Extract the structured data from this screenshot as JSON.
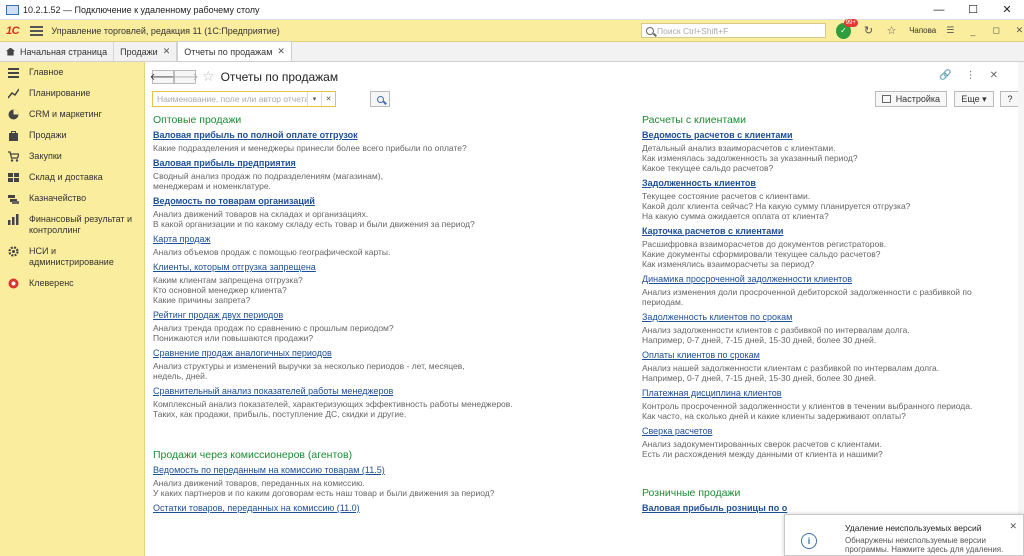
{
  "window": {
    "title": "10.2.1.52 — Подключение к удаленному рабочему столу",
    "controls": [
      "—",
      "☐",
      "✕"
    ]
  },
  "appbar": {
    "logo": "1С",
    "title": "Управление торговлей, редакция 11  (1С:Предприятие)",
    "search_placeholder": "Поиск Ctrl+Shift+F",
    "notif_count": "99+",
    "user": "Чапова",
    "menu": "☰",
    "controls": [
      "_",
      "◻",
      "✕"
    ]
  },
  "tabs": [
    {
      "label": "Начальная страница",
      "closable": false
    },
    {
      "label": "Продажи",
      "closable": true
    },
    {
      "label": "Отчеты по продажам",
      "closable": true,
      "active": true
    }
  ],
  "sidebar": {
    "items": [
      {
        "label": "Главное",
        "icon": "menu-icon"
      },
      {
        "label": "Планирование",
        "icon": "chart-icon"
      },
      {
        "label": "CRM и маркетинг",
        "icon": "pie-icon"
      },
      {
        "label": "Продажи",
        "icon": "bag-icon"
      },
      {
        "label": "Закупки",
        "icon": "cart-icon"
      },
      {
        "label": "Склад и доставка",
        "icon": "warehouse-icon"
      },
      {
        "label": "Казначейство",
        "icon": "money-icon"
      },
      {
        "label": "Финансовый результат и контроллинг",
        "icon": "finance-icon"
      },
      {
        "label": "НСИ и администрирование",
        "icon": "gear-icon"
      },
      {
        "label": "Клеверенс",
        "icon": "cleverence-icon"
      }
    ]
  },
  "page": {
    "title": "Отчеты по продажам",
    "back": "🡐",
    "forward": "🡒",
    "filter_placeholder": "Наименование, поле или автор отчета",
    "settings_label": "Настройка",
    "more_label": "Еще",
    "help_label": "?"
  },
  "left_groups": [
    {
      "title": "Оптовые продажи",
      "reports": [
        {
          "name": "Валовая прибыль по полной оплате отгрузок",
          "bold": true,
          "desc": [
            "Какие подразделения и менеджеры принесли более всего прибыли по оплате?"
          ]
        },
        {
          "name": "Валовая прибыль предприятия",
          "bold": true,
          "desc": [
            "Сводный анализ продаж по подразделениям (магазинам),",
            "менеджерам и номенклатуре."
          ]
        },
        {
          "name": "Ведомость по товарам организаций",
          "bold": true,
          "desc": [
            "Анализ движений товаров на складах и организациях.",
            "В какой организации и по какому складу есть товар и были движения за период?"
          ]
        },
        {
          "name": "Карта продаж",
          "bold": false,
          "desc": [
            "Анализ объемов продаж с помощью географической карты."
          ]
        },
        {
          "name": "Клиенты, которым отгрузка запрещена",
          "bold": false,
          "desc": [
            "Каким клиентам запрещена отгрузка?",
            "Кто основной менеджер клиента?",
            "Какие причины запрета?"
          ]
        },
        {
          "name": "Рейтинг продаж двух периодов",
          "bold": false,
          "desc": [
            "Анализ тренда продаж по сравнению с прошлым периодом?",
            "Понижаются или повышаются продажи?"
          ]
        },
        {
          "name": "Сравнение продаж аналогичных периодов",
          "bold": false,
          "desc": [
            "Анализ структуры и изменений выручки за несколько периодов - лет, месяцев,",
            "недель, дней."
          ]
        },
        {
          "name": "Сравнительный анализ показателей работы менеджеров",
          "bold": false,
          "desc": [
            "Комплексный анализ показателей, характеризующих эффективность работы менеджеров.",
            "Таких, как продажи, прибыль, поступление ДС, скидки и другие."
          ]
        }
      ]
    },
    {
      "title": "Продажи через комиссионеров (агентов)",
      "reports": [
        {
          "name": "Ведомость по переданным на комиссию товарам (11.5)",
          "bold": false,
          "desc": [
            "Анализ движений товаров, переданных на комиссию.",
            "У каких партнеров и по каким договорам есть наш товар и были движения за период?"
          ]
        },
        {
          "name": "Остатки товаров, переданных на комиссию (11.0)",
          "bold": false,
          "desc": []
        }
      ]
    }
  ],
  "right_groups": [
    {
      "title": "Расчеты с клиентами",
      "reports": [
        {
          "name": "Ведомость расчетов с клиентами",
          "bold": true,
          "desc": [
            "Детальный анализ взаиморасчетов с клиентами.",
            "Как изменялась задолженность за указанный период?",
            "Какое текущее сальдо расчетов?"
          ]
        },
        {
          "name": "Задолженность клиентов",
          "bold": true,
          "desc": [
            "Текущее состояние расчетов с клиентами.",
            "Какой долг клиента сейчас? На какую сумму планируется отгрузка?",
            "На какую сумма ожидается оплата от клиента?"
          ]
        },
        {
          "name": "Карточка расчетов с клиентами",
          "bold": true,
          "desc": [
            "Расшифровка взаиморасчетов до документов регистраторов.",
            "Какие документы сформировали текущее сальдо расчетов?",
            "Как изменялись взаиморасчеты за период?"
          ]
        },
        {
          "name": "Динамика просроченной задолженности клиентов",
          "bold": false,
          "desc": [
            "Анализ изменения доли просроченной дебиторской задолженности с разбивкой по",
            "периодам."
          ]
        },
        {
          "name": "Задолженность клиентов по срокам",
          "bold": false,
          "desc": [
            "Анализ задолженности клиентов с разбивкой по интервалам долга.",
            "Например, 0-7 дней, 7-15 дней, 15-30 дней, более 30 дней."
          ]
        },
        {
          "name": "Оплаты клиентов по срокам",
          "bold": false,
          "desc": [
            "Анализ нашей задолженности клиентам с разбивкой по интервалам долга.",
            "Например, 0-7 дней, 7-15 дней, 15-30 дней, более 30 дней."
          ]
        },
        {
          "name": "Платежная дисциплина клиентов",
          "bold": false,
          "desc": [
            "Контроль просроченной задолженности у клиентов в течении выбранного периода.",
            "Как часто, на сколько дней и какие клиенты задерживают оплаты?"
          ]
        },
        {
          "name": "Сверка расчетов",
          "bold": false,
          "desc": [
            "Анализ задокументированных сверок расчетов с клиентами.",
            "Есть ли расхождения между данными от клиента и нашими?"
          ]
        }
      ]
    },
    {
      "title": "Розничные продажи",
      "reports": [
        {
          "name": "Валовая прибыль розницы по о",
          "bold": true,
          "desc": []
        }
      ]
    }
  ],
  "popup": {
    "title": "Удаление неиспользуемых версий",
    "text": "Обнаружены неиспользуемые версии программы. Нажмите здесь для удаления.",
    "icon": "info-icon"
  },
  "colors": {
    "accent_yellow": "#fbed9e",
    "group_green": "#1a8c34",
    "link_blue": "#1d4f97"
  }
}
